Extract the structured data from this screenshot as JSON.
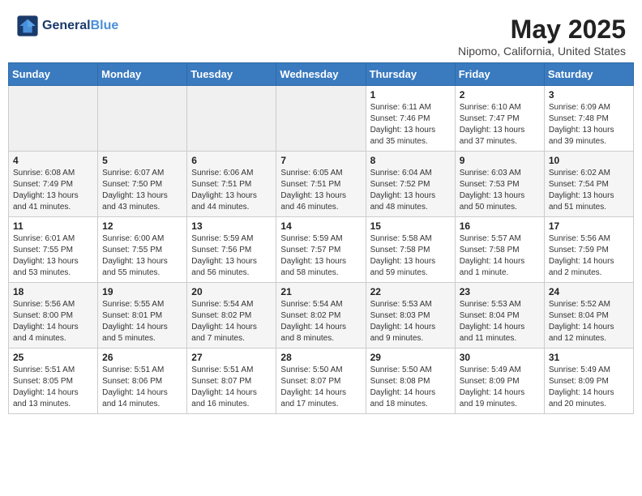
{
  "header": {
    "logo_line1": "General",
    "logo_line2": "Blue",
    "title": "May 2025",
    "subtitle": "Nipomo, California, United States"
  },
  "calendar": {
    "days_of_week": [
      "Sunday",
      "Monday",
      "Tuesday",
      "Wednesday",
      "Thursday",
      "Friday",
      "Saturday"
    ],
    "weeks": [
      [
        {
          "day": "",
          "info": ""
        },
        {
          "day": "",
          "info": ""
        },
        {
          "day": "",
          "info": ""
        },
        {
          "day": "",
          "info": ""
        },
        {
          "day": "1",
          "info": "Sunrise: 6:11 AM\nSunset: 7:46 PM\nDaylight: 13 hours\nand 35 minutes."
        },
        {
          "day": "2",
          "info": "Sunrise: 6:10 AM\nSunset: 7:47 PM\nDaylight: 13 hours\nand 37 minutes."
        },
        {
          "day": "3",
          "info": "Sunrise: 6:09 AM\nSunset: 7:48 PM\nDaylight: 13 hours\nand 39 minutes."
        }
      ],
      [
        {
          "day": "4",
          "info": "Sunrise: 6:08 AM\nSunset: 7:49 PM\nDaylight: 13 hours\nand 41 minutes."
        },
        {
          "day": "5",
          "info": "Sunrise: 6:07 AM\nSunset: 7:50 PM\nDaylight: 13 hours\nand 43 minutes."
        },
        {
          "day": "6",
          "info": "Sunrise: 6:06 AM\nSunset: 7:51 PM\nDaylight: 13 hours\nand 44 minutes."
        },
        {
          "day": "7",
          "info": "Sunrise: 6:05 AM\nSunset: 7:51 PM\nDaylight: 13 hours\nand 46 minutes."
        },
        {
          "day": "8",
          "info": "Sunrise: 6:04 AM\nSunset: 7:52 PM\nDaylight: 13 hours\nand 48 minutes."
        },
        {
          "day": "9",
          "info": "Sunrise: 6:03 AM\nSunset: 7:53 PM\nDaylight: 13 hours\nand 50 minutes."
        },
        {
          "day": "10",
          "info": "Sunrise: 6:02 AM\nSunset: 7:54 PM\nDaylight: 13 hours\nand 51 minutes."
        }
      ],
      [
        {
          "day": "11",
          "info": "Sunrise: 6:01 AM\nSunset: 7:55 PM\nDaylight: 13 hours\nand 53 minutes."
        },
        {
          "day": "12",
          "info": "Sunrise: 6:00 AM\nSunset: 7:55 PM\nDaylight: 13 hours\nand 55 minutes."
        },
        {
          "day": "13",
          "info": "Sunrise: 5:59 AM\nSunset: 7:56 PM\nDaylight: 13 hours\nand 56 minutes."
        },
        {
          "day": "14",
          "info": "Sunrise: 5:59 AM\nSunset: 7:57 PM\nDaylight: 13 hours\nand 58 minutes."
        },
        {
          "day": "15",
          "info": "Sunrise: 5:58 AM\nSunset: 7:58 PM\nDaylight: 13 hours\nand 59 minutes."
        },
        {
          "day": "16",
          "info": "Sunrise: 5:57 AM\nSunset: 7:58 PM\nDaylight: 14 hours\nand 1 minute."
        },
        {
          "day": "17",
          "info": "Sunrise: 5:56 AM\nSunset: 7:59 PM\nDaylight: 14 hours\nand 2 minutes."
        }
      ],
      [
        {
          "day": "18",
          "info": "Sunrise: 5:56 AM\nSunset: 8:00 PM\nDaylight: 14 hours\nand 4 minutes."
        },
        {
          "day": "19",
          "info": "Sunrise: 5:55 AM\nSunset: 8:01 PM\nDaylight: 14 hours\nand 5 minutes."
        },
        {
          "day": "20",
          "info": "Sunrise: 5:54 AM\nSunset: 8:02 PM\nDaylight: 14 hours\nand 7 minutes."
        },
        {
          "day": "21",
          "info": "Sunrise: 5:54 AM\nSunset: 8:02 PM\nDaylight: 14 hours\nand 8 minutes."
        },
        {
          "day": "22",
          "info": "Sunrise: 5:53 AM\nSunset: 8:03 PM\nDaylight: 14 hours\nand 9 minutes."
        },
        {
          "day": "23",
          "info": "Sunrise: 5:53 AM\nSunset: 8:04 PM\nDaylight: 14 hours\nand 11 minutes."
        },
        {
          "day": "24",
          "info": "Sunrise: 5:52 AM\nSunset: 8:04 PM\nDaylight: 14 hours\nand 12 minutes."
        }
      ],
      [
        {
          "day": "25",
          "info": "Sunrise: 5:51 AM\nSunset: 8:05 PM\nDaylight: 14 hours\nand 13 minutes."
        },
        {
          "day": "26",
          "info": "Sunrise: 5:51 AM\nSunset: 8:06 PM\nDaylight: 14 hours\nand 14 minutes."
        },
        {
          "day": "27",
          "info": "Sunrise: 5:51 AM\nSunset: 8:07 PM\nDaylight: 14 hours\nand 16 minutes."
        },
        {
          "day": "28",
          "info": "Sunrise: 5:50 AM\nSunset: 8:07 PM\nDaylight: 14 hours\nand 17 minutes."
        },
        {
          "day": "29",
          "info": "Sunrise: 5:50 AM\nSunset: 8:08 PM\nDaylight: 14 hours\nand 18 minutes."
        },
        {
          "day": "30",
          "info": "Sunrise: 5:49 AM\nSunset: 8:09 PM\nDaylight: 14 hours\nand 19 minutes."
        },
        {
          "day": "31",
          "info": "Sunrise: 5:49 AM\nSunset: 8:09 PM\nDaylight: 14 hours\nand 20 minutes."
        }
      ]
    ]
  }
}
